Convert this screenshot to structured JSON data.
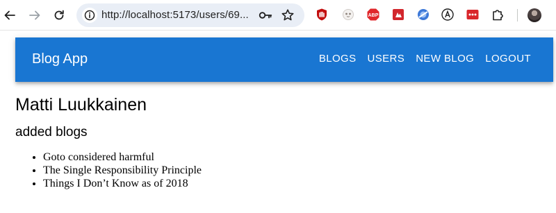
{
  "browser": {
    "url": "http://localhost:5173/users/69..."
  },
  "icons": {
    "back": "arrow-left-icon",
    "forward": "arrow-right-icon",
    "reload": "reload-icon",
    "site_info": "site-info-icon",
    "key": "key-icon",
    "bookmark": "star-icon",
    "extensions": [
      "ublock-icon",
      "sloth-icon",
      "adblock-plus-icon",
      "red-extension-icon",
      "blue-extension-icon",
      "a-extension-icon",
      "dots-extension-icon",
      "puzzle-icon"
    ],
    "profile": "avatar"
  },
  "app": {
    "title": "Blog App",
    "nav": {
      "blogs": "BLOGS",
      "users": "USERS",
      "new_blog": "NEW BLOG",
      "logout": "LOGOUT"
    },
    "color": "#1976d2"
  },
  "user": {
    "name": "Matti Luukkainen",
    "added_blogs_heading": "added blogs",
    "blogs": [
      "Goto considered harmful",
      "The Single Responsibility Principle",
      "Things I Don’t Know as of 2018"
    ]
  }
}
